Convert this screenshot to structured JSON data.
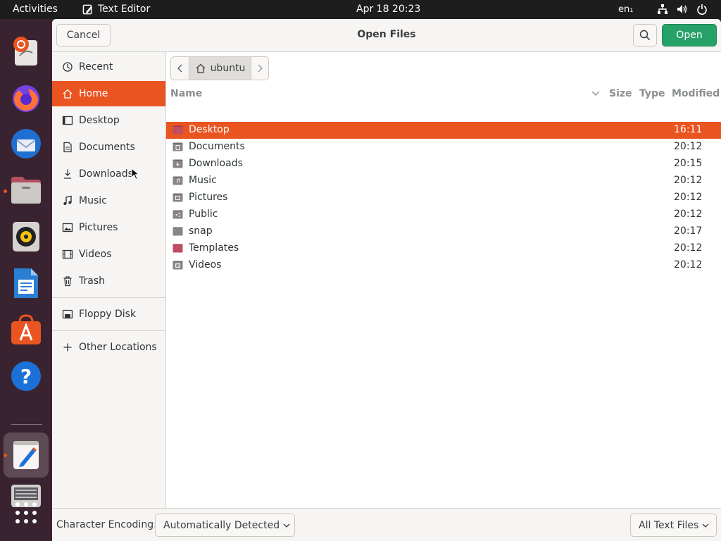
{
  "topbar": {
    "activities": "Activities",
    "app_name": "Text Editor",
    "clock": "Apr 18  20:23",
    "language": "en₁"
  },
  "dock": {
    "apps": [
      "ubuntu-installer-icon",
      "firefox-icon",
      "thunderbird-icon",
      "files-icon",
      "rhythmbox-icon",
      "libreoffice-writer-icon",
      "app-center-icon",
      "help-icon",
      "text-editor-icon",
      "scanner-icon",
      "show-apps-icon"
    ]
  },
  "dialog": {
    "title": "Open Files",
    "cancel_label": "Cancel",
    "open_label": "Open"
  },
  "sidebar": {
    "items": [
      {
        "label": "Recent",
        "icon": "clock-icon"
      },
      {
        "label": "Home",
        "icon": "home-icon"
      },
      {
        "label": "Desktop",
        "icon": "desktop-icon"
      },
      {
        "label": "Documents",
        "icon": "document-icon"
      },
      {
        "label": "Downloads",
        "icon": "download-icon"
      },
      {
        "label": "Music",
        "icon": "music-icon"
      },
      {
        "label": "Pictures",
        "icon": "pictures-icon"
      },
      {
        "label": "Videos",
        "icon": "video-icon"
      },
      {
        "label": "Trash",
        "icon": "trash-icon"
      },
      {
        "label": "Floppy Disk",
        "icon": "floppy-icon"
      },
      {
        "label": "Other Locations",
        "icon": "plus-icon"
      }
    ]
  },
  "pathbar": {
    "current": "ubuntu"
  },
  "file_list": {
    "columns": {
      "name": "Name",
      "size": "Size",
      "type": "Type",
      "modified": "Modified"
    },
    "rows": [
      {
        "name": "Desktop",
        "modified": "16:11"
      },
      {
        "name": "Documents",
        "modified": "20:12"
      },
      {
        "name": "Downloads",
        "modified": "20:15"
      },
      {
        "name": "Music",
        "modified": "20:12"
      },
      {
        "name": "Pictures",
        "modified": "20:12"
      },
      {
        "name": "Public",
        "modified": "20:12"
      },
      {
        "name": "snap",
        "modified": "20:17"
      },
      {
        "name": "Templates",
        "modified": "20:12"
      },
      {
        "name": "Videos",
        "modified": "20:12"
      }
    ]
  },
  "footer": {
    "encoding_label": "Character Encoding:",
    "encoding_value": "Automatically Detected",
    "filter_value": "All Text Files"
  },
  "colors": {
    "accent": "#e95420",
    "open_button": "#26a269",
    "dock_bg": "#3a2330"
  }
}
